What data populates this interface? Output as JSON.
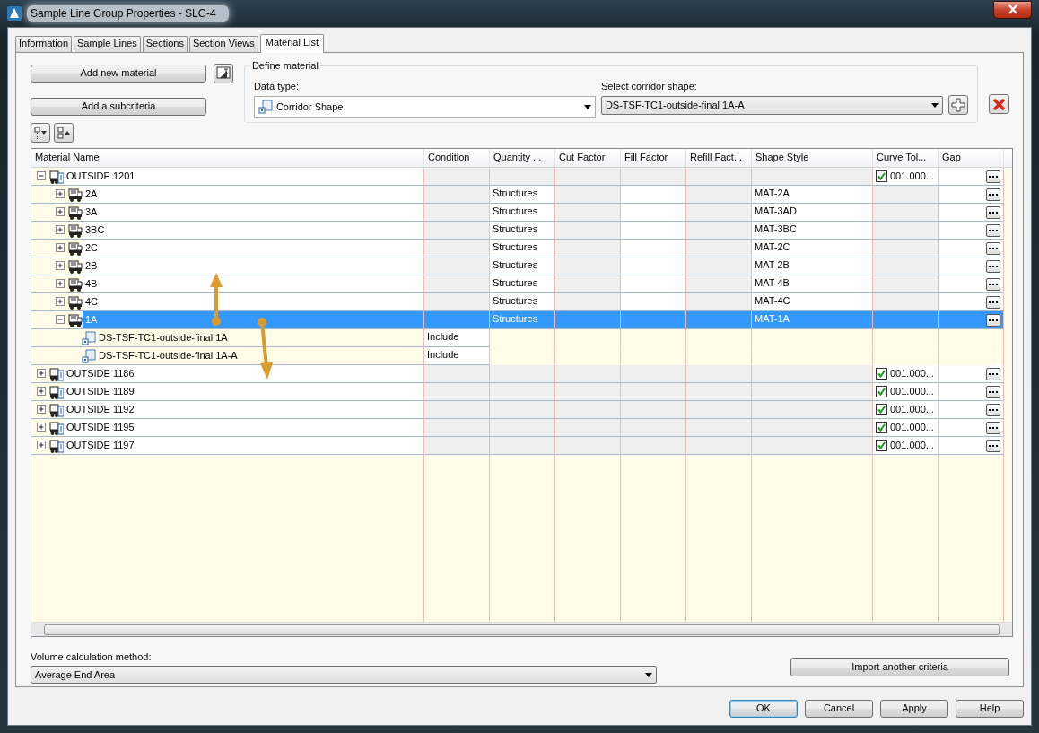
{
  "window": {
    "title": "Sample Line Group Properties - SLG-4"
  },
  "tabs": [
    {
      "label": "Information",
      "selected": false
    },
    {
      "label": "Sample Lines",
      "selected": false
    },
    {
      "label": "Sections",
      "selected": false
    },
    {
      "label": "Section Views",
      "selected": false
    },
    {
      "label": "Material List",
      "selected": true
    }
  ],
  "actions": {
    "add_material": "Add new material",
    "add_subcriteria": "Add a subcriteria"
  },
  "define_material": {
    "title": "Define material",
    "data_type_label": "Data type:",
    "data_type": "Corridor Shape",
    "shape_label": "Select corridor shape:",
    "shape": "DS-TSF-TC1-outside-final 1A-A"
  },
  "table": {
    "columns": [
      "Material Name",
      "Condition",
      "Quantity ...",
      "Cut Factor",
      "Fill Factor",
      "Refill Fact...",
      "Shape Style",
      "Curve Tol...",
      "Gap"
    ],
    "rows": [
      {
        "kind": "group",
        "name": "OUTSIDE 1201",
        "expanded": true,
        "selected": false,
        "curve_tolerance": "001.000...",
        "checked": true,
        "children": [
          {
            "kind": "material",
            "name": "2A",
            "expanded": false,
            "selected": false,
            "quantity": "Structures",
            "shape_style": "MAT-2A"
          },
          {
            "kind": "material",
            "name": "3A",
            "expanded": false,
            "selected": false,
            "quantity": "Structures",
            "shape_style": "MAT-3AD"
          },
          {
            "kind": "material",
            "name": "3BC",
            "expanded": false,
            "selected": false,
            "quantity": "Structures",
            "shape_style": "MAT-3BC"
          },
          {
            "kind": "material",
            "name": "2C",
            "expanded": false,
            "selected": false,
            "quantity": "Structures",
            "shape_style": "MAT-2C"
          },
          {
            "kind": "material",
            "name": "2B",
            "expanded": false,
            "selected": false,
            "quantity": "Structures",
            "shape_style": "MAT-2B"
          },
          {
            "kind": "material",
            "name": "4B",
            "expanded": false,
            "selected": false,
            "quantity": "Structures",
            "shape_style": "MAT-4B"
          },
          {
            "kind": "material",
            "name": "4C",
            "expanded": false,
            "selected": false,
            "quantity": "Structures",
            "shape_style": "MAT-4C"
          },
          {
            "kind": "material",
            "name": "1A",
            "expanded": true,
            "selected": true,
            "quantity": "Structures",
            "shape_style": "MAT-1A",
            "children": [
              {
                "kind": "shape",
                "name": "DS-TSF-TC1-outside-final 1A",
                "condition": "Include"
              },
              {
                "kind": "shape",
                "name": "DS-TSF-TC1-outside-final 1A-A",
                "condition": "Include"
              }
            ]
          }
        ]
      },
      {
        "kind": "group",
        "name": "OUTSIDE 1186",
        "expanded": false,
        "selected": false,
        "curve_tolerance": "001.000...",
        "checked": true
      },
      {
        "kind": "group",
        "name": "OUTSIDE 1189",
        "expanded": false,
        "selected": false,
        "curve_tolerance": "001.000...",
        "checked": true
      },
      {
        "kind": "group",
        "name": "OUTSIDE 1192",
        "expanded": false,
        "selected": false,
        "curve_tolerance": "001.000...",
        "checked": true
      },
      {
        "kind": "group",
        "name": "OUTSIDE 1195",
        "expanded": false,
        "selected": false,
        "curve_tolerance": "001.000...",
        "checked": true
      },
      {
        "kind": "group",
        "name": "OUTSIDE 1197",
        "expanded": false,
        "selected": false,
        "curve_tolerance": "001.000...",
        "checked": true
      }
    ]
  },
  "volume": {
    "label": "Volume calculation method:",
    "value": "Average End Area"
  },
  "import_button": "Import another criteria",
  "footer_buttons": [
    {
      "label": "OK",
      "default": true
    },
    {
      "label": "Cancel",
      "default": false
    },
    {
      "label": "Apply",
      "default": false
    },
    {
      "label": "Help",
      "default": false
    }
  ]
}
